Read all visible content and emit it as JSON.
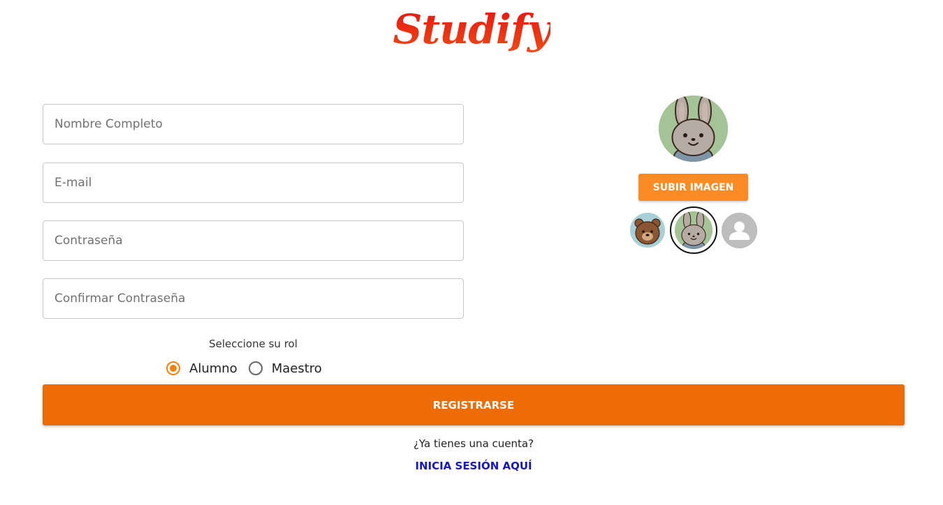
{
  "brand": {
    "logo_text": "Studify",
    "color": "#e61e12"
  },
  "form": {
    "name_placeholder": "Nombre Completo",
    "email_placeholder": "E-mail",
    "password_placeholder": "Contraseña",
    "confirm_placeholder": "Confirmar Contraseña",
    "role_title": "Seleccione su rol",
    "roles": [
      {
        "label": "Alumno",
        "selected": true
      },
      {
        "label": "Maestro",
        "selected": false
      }
    ],
    "submit_label": "REGISTRARSE"
  },
  "avatar": {
    "upload_label": "SUBIR IMAGEN",
    "selected": "bunny",
    "options": [
      "bear-avatar",
      "bunny-avatar",
      "default-user-avatar"
    ]
  },
  "footer": {
    "have_account_text": "¿Ya tienes una cuenta?",
    "login_link_label": "INICIA SESIÓN AQUÍ"
  },
  "colors": {
    "primary": "#ee6c06",
    "upload": "#fb8b24",
    "link": "#1515c8",
    "radio_accent": "#f0800f"
  }
}
